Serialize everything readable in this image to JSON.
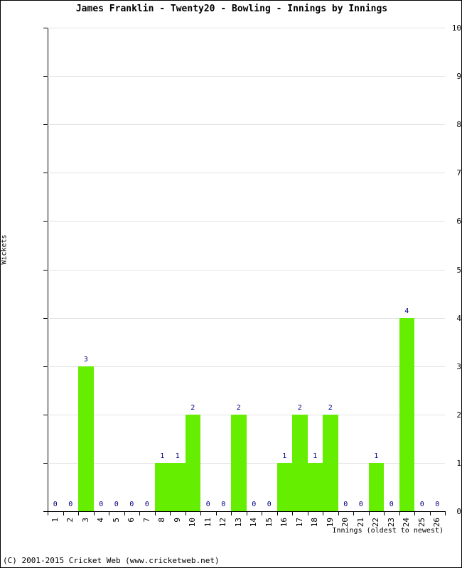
{
  "chart_data": {
    "type": "bar",
    "title": "James Franklin - Twenty20 - Bowling - Innings by Innings",
    "xlabel": "Innings (oldest to newest)",
    "ylabel": "Wickets",
    "categories": [
      "1",
      "2",
      "3",
      "4",
      "5",
      "6",
      "7",
      "8",
      "9",
      "10",
      "11",
      "12",
      "13",
      "14",
      "15",
      "16",
      "17",
      "18",
      "19",
      "20",
      "21",
      "22",
      "23",
      "24",
      "25",
      "26"
    ],
    "values": [
      0,
      0,
      3,
      0,
      0,
      0,
      0,
      1,
      1,
      2,
      0,
      0,
      2,
      0,
      0,
      1,
      2,
      1,
      2,
      0,
      0,
      1,
      0,
      4,
      0,
      0
    ],
    "ylim": [
      0,
      10
    ],
    "yticks": [
      "0",
      "1",
      "2",
      "3",
      "4",
      "5",
      "6",
      "7",
      "8",
      "9",
      "10"
    ],
    "grid": true,
    "legend": "none",
    "bar_color": "#66ee00",
    "value_label_color": "#000080"
  },
  "footer": {
    "copyright": "(C) 2001-2015 Cricket Web (www.cricketweb.net)"
  }
}
